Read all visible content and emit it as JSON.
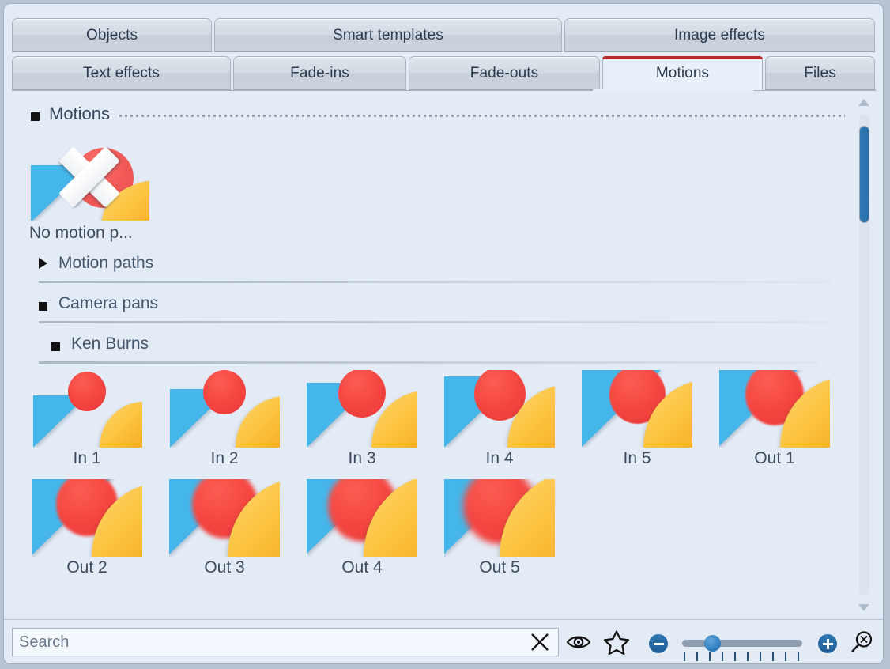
{
  "window": {
    "background_color": "#e3ebf6",
    "border_color": "#9fb0c4"
  },
  "tabs": {
    "accent_color": "#b42a2a",
    "row1": [
      {
        "id": "objects",
        "label": "Objects",
        "active": false
      },
      {
        "id": "smart-templates",
        "label": "Smart templates",
        "active": false
      },
      {
        "id": "image-effects",
        "label": "Image effects",
        "active": false
      }
    ],
    "row2": [
      {
        "id": "text-effects",
        "label": "Text effects",
        "active": false
      },
      {
        "id": "fade-ins",
        "label": "Fade-ins",
        "active": false
      },
      {
        "id": "fade-outs",
        "label": "Fade-outs",
        "active": false
      },
      {
        "id": "motions",
        "label": "Motions",
        "active": true
      },
      {
        "id": "files",
        "label": "Files",
        "active": false
      }
    ]
  },
  "content": {
    "group": {
      "label": "Motions",
      "expanded": true
    },
    "no_motion": {
      "label": "No motion p...",
      "icon": "no-motion-icon"
    },
    "sections": [
      {
        "id": "motion-paths",
        "label": "Motion paths",
        "expanded": false
      },
      {
        "id": "camera-pans",
        "label": "Camera pans",
        "expanded": true
      },
      {
        "id": "ken-burns",
        "label": "Ken Burns",
        "expanded": true
      }
    ],
    "ken_burns_items": [
      {
        "label": "In 1",
        "zoom": 1.0
      },
      {
        "label": "In 2",
        "zoom": 1.12
      },
      {
        "label": "In 3",
        "zoom": 1.24
      },
      {
        "label": "In 4",
        "zoom": 1.36
      },
      {
        "label": "In 5",
        "zoom": 1.48
      },
      {
        "label": "Out 1",
        "zoom": 1.55
      },
      {
        "label": "Out 2",
        "zoom": 1.62
      },
      {
        "label": "Out 3",
        "zoom": 1.72
      },
      {
        "label": "Out 4",
        "zoom": 1.82
      },
      {
        "label": "Out 5",
        "zoom": 1.92
      }
    ]
  },
  "scrollbar": {
    "up_arrow": "chevron-up-icon",
    "down_arrow": "chevron-down-icon",
    "thumb_color": "#2f78b5"
  },
  "bottombar": {
    "search": {
      "value": "",
      "placeholder": "Search"
    },
    "clear_icon": "close-icon",
    "preview_icon": "eye-icon",
    "favorite_icon": "star-icon",
    "zoom_out_label": "−",
    "zoom_in_label": "+",
    "zoom_value": 20,
    "zoom_min": 0,
    "zoom_max": 100,
    "fit_icon": "zoom-fit-icon"
  }
}
